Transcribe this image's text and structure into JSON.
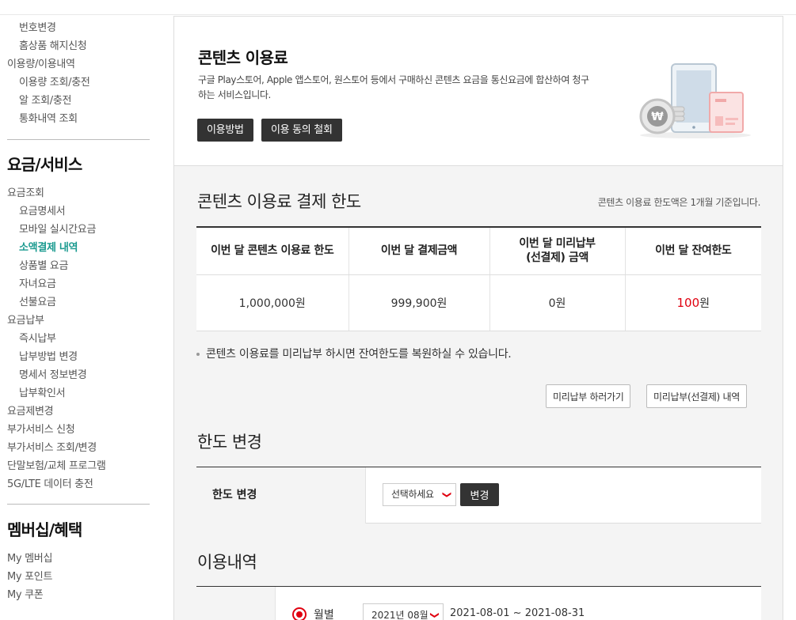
{
  "sidebar": {
    "items_top": [
      {
        "label": "번호변경",
        "level": "sub"
      },
      {
        "label": "홈상품 해지신청",
        "level": "sub"
      },
      {
        "label": "이용량/이용내역",
        "level": "top"
      },
      {
        "label": "이용량 조회/충전",
        "level": "sub"
      },
      {
        "label": "알 조회/충전",
        "level": "sub"
      },
      {
        "label": "통화내역 조회",
        "level": "sub"
      }
    ],
    "billing_heading": "요금/서비스",
    "billing_items": [
      {
        "label": "요금조회",
        "level": "top"
      },
      {
        "label": "요금명세서",
        "level": "sub"
      },
      {
        "label": "모바일 실시간요금",
        "level": "sub"
      },
      {
        "label": "소액결제 내역",
        "level": "sub",
        "active": true
      },
      {
        "label": "상품별 요금",
        "level": "sub"
      },
      {
        "label": "자녀요금",
        "level": "sub"
      },
      {
        "label": "선불요금",
        "level": "sub"
      },
      {
        "label": "요금납부",
        "level": "top"
      },
      {
        "label": "즉시납부",
        "level": "sub"
      },
      {
        "label": "납부방법 변경",
        "level": "sub"
      },
      {
        "label": "명세서 정보변경",
        "level": "sub"
      },
      {
        "label": "납부확인서",
        "level": "sub"
      },
      {
        "label": "요금제변경",
        "level": "top"
      },
      {
        "label": "부가서비스 신청",
        "level": "top"
      },
      {
        "label": "부가서비스 조회/변경",
        "level": "top"
      },
      {
        "label": "단말보험/교체 프로그램",
        "level": "top"
      },
      {
        "label": "5G/LTE 데이터 충전",
        "level": "top"
      }
    ],
    "membership_heading": "멤버십/혜택",
    "membership_items": [
      {
        "label": "My 멤버십"
      },
      {
        "label": "My 포인트"
      },
      {
        "label": "My 쿠폰"
      }
    ]
  },
  "hero": {
    "title": "콘텐츠 이용료",
    "description": "구글 Play스토어, Apple 앱스토어, 원스토어 등에서 구매하신 콘텐츠 요금을 통신요금에 합산하여 청구하는 서비스입니다.",
    "btn_usage": "이용방법",
    "btn_withdraw": "이용 동의 철회",
    "art_icon": "won-coin-tablet-icon"
  },
  "limit": {
    "title": "콘텐츠 이용료 결제 한도",
    "note": "콘텐츠 이용료 한도액은 1개월 기준입니다.",
    "headers": [
      "이번 달 콘텐츠 이용료 한도",
      "이번 달 결제금액",
      "이번 달 미리납부\n(선결제) 금액",
      "이번 달 잔여한도"
    ],
    "values": [
      "1,000,000원",
      "999,900원",
      "0원"
    ],
    "remaining_number": "100",
    "remaining_unit": "원",
    "bullet": "콘텐츠 이용료를 미리납부 하시면 잔여한도를 복원하실 수 있습니다.",
    "btn_prepay": "미리납부 하러가기",
    "btn_prepay_history": "미리납부(선결제) 내역"
  },
  "change": {
    "title": "한도 변경",
    "label": "한도 변경",
    "select_value": "선택하세요",
    "btn": "변경"
  },
  "usage": {
    "title": "이용내역",
    "radio_label": "월별",
    "month_value": "2021년 08월",
    "period": "2021-08-01 ~ 2021-08-31"
  },
  "colors": {
    "accent_red": "#e0000f",
    "active_teal": "#1a9a8f",
    "dark_button": "#333333"
  }
}
